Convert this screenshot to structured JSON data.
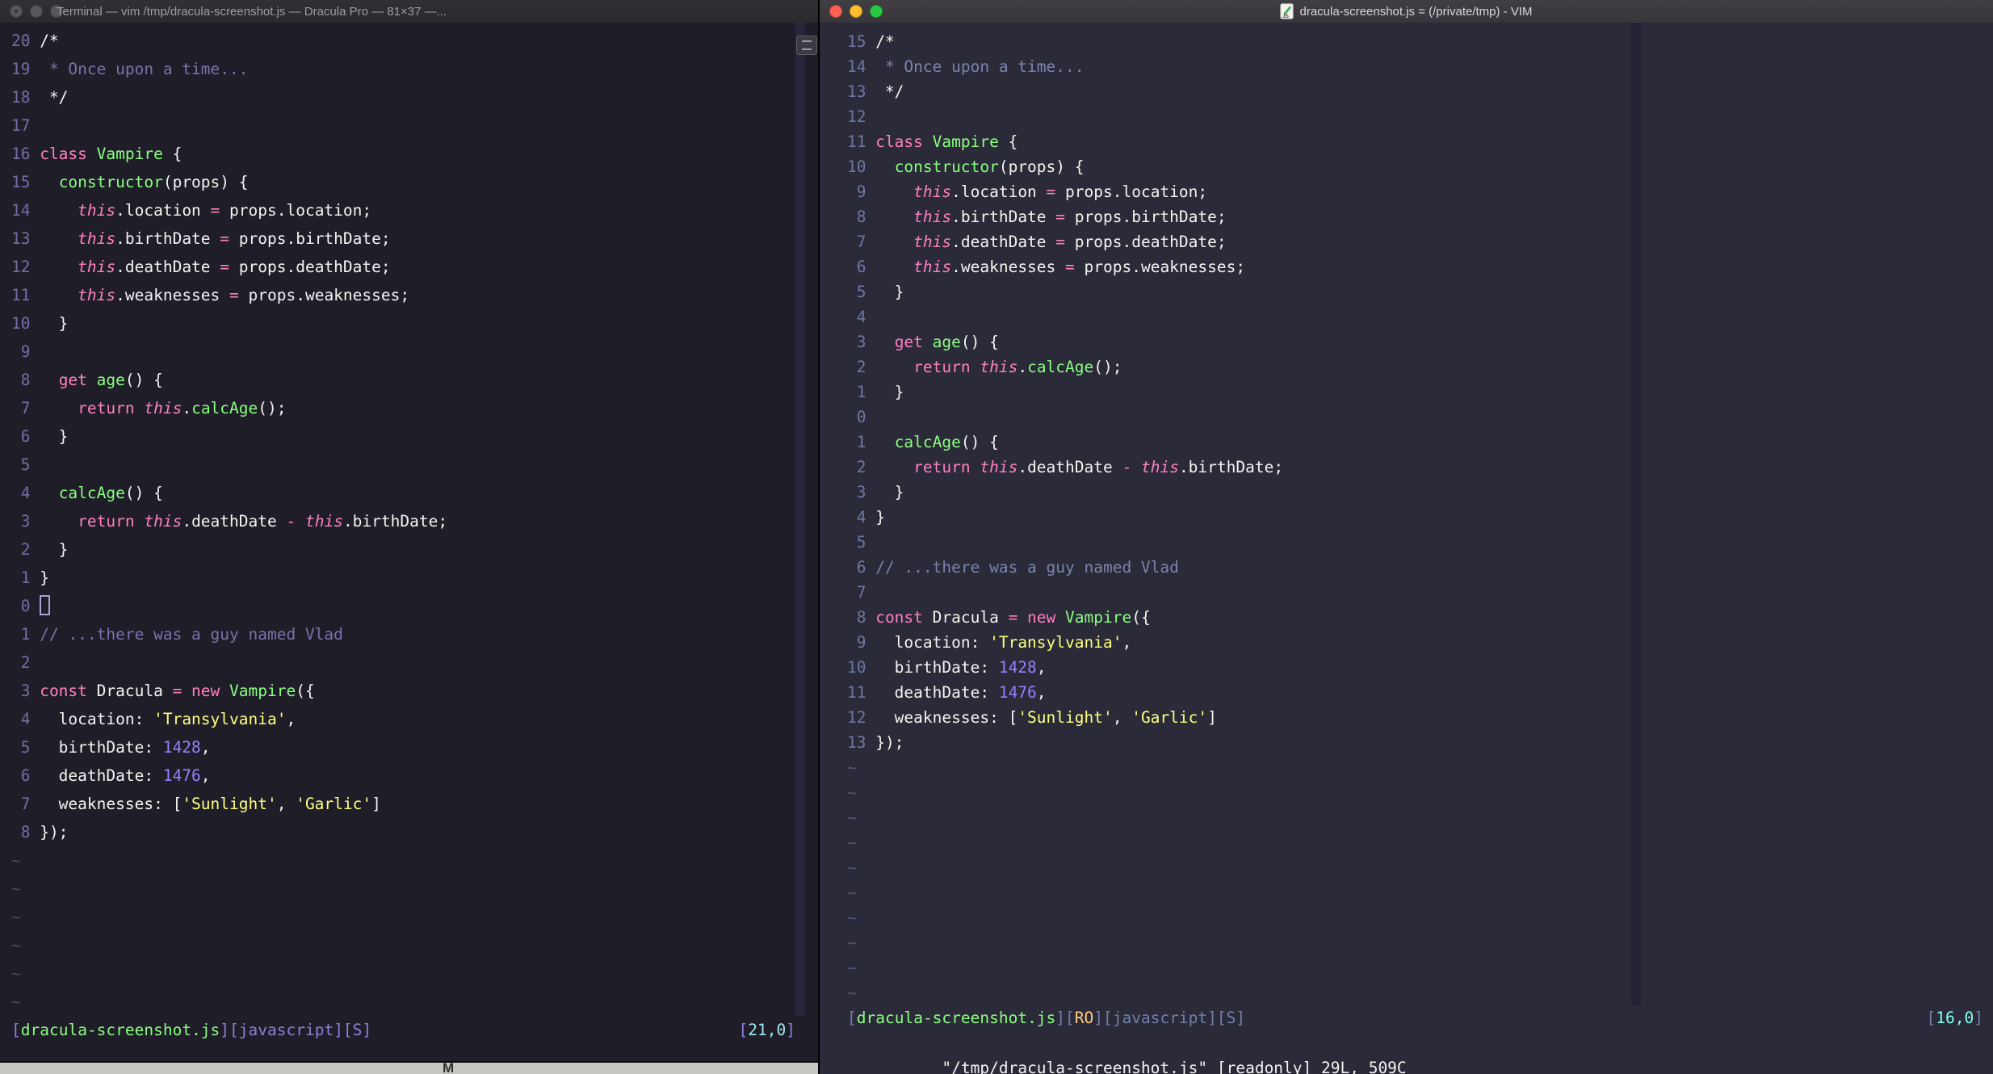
{
  "palette": {
    "terminal_bg": "#1f1e28",
    "gui_bg": "#2a2a38",
    "foreground": "#f4f4ef",
    "pink": "#ff80bf",
    "green": "#8aff80",
    "yellow": "#ffff80",
    "purple": "#9580ff",
    "comment": "#7a72ab",
    "cyan": "#80ffea",
    "orange": "#ffca80",
    "traffic_red": "#ff5f57",
    "traffic_yellow": "#febc2e",
    "traffic_green": "#28c840"
  },
  "tilde_char": "~",
  "desktop": {
    "glyph": "M"
  },
  "left_window": {
    "title": "Terminal — vim /tmp/dracula-screenshot.js — Dracula Pro — 81×37 —...",
    "tildes": 6,
    "command_line": "",
    "status_tokens": [
      [
        "br",
        "["
      ],
      [
        "sg",
        "dracula-screenshot.js"
      ],
      [
        "br",
        "]["
      ],
      [
        "si",
        "javascript"
      ],
      [
        "br",
        "]["
      ],
      [
        "si",
        "S"
      ],
      [
        "br",
        "]"
      ]
    ],
    "ruler_tokens": [
      [
        "br",
        "["
      ],
      [
        "sc",
        "21,0"
      ],
      [
        "br",
        "]"
      ]
    ],
    "code_lines": [
      {
        "n": "20",
        "t": [
          [
            "fg",
            "/*"
          ]
        ]
      },
      {
        "n": "19",
        "t": [
          [
            "cm",
            " * Once upon a time..."
          ]
        ]
      },
      {
        "n": "18",
        "t": [
          [
            "fg",
            " */"
          ]
        ]
      },
      {
        "n": "17",
        "t": []
      },
      {
        "n": "16",
        "t": [
          [
            "pk",
            "class "
          ],
          [
            "gr",
            "Vampire"
          ],
          [
            "fg",
            " {"
          ]
        ]
      },
      {
        "n": "15",
        "t": [
          [
            "fg",
            "  "
          ],
          [
            "gr",
            "constructor"
          ],
          [
            "fg",
            "(props) {"
          ]
        ]
      },
      {
        "n": "14",
        "t": [
          [
            "fg",
            "    "
          ],
          [
            "pki",
            "this"
          ],
          [
            "fg",
            ".location "
          ],
          [
            "pk",
            "="
          ],
          [
            "fg",
            " props.location;"
          ]
        ]
      },
      {
        "n": "13",
        "t": [
          [
            "fg",
            "    "
          ],
          [
            "pki",
            "this"
          ],
          [
            "fg",
            ".birthDate "
          ],
          [
            "pk",
            "="
          ],
          [
            "fg",
            " props.birthDate;"
          ]
        ]
      },
      {
        "n": "12",
        "t": [
          [
            "fg",
            "    "
          ],
          [
            "pki",
            "this"
          ],
          [
            "fg",
            ".deathDate "
          ],
          [
            "pk",
            "="
          ],
          [
            "fg",
            " props.deathDate;"
          ]
        ]
      },
      {
        "n": "11",
        "t": [
          [
            "fg",
            "    "
          ],
          [
            "pki",
            "this"
          ],
          [
            "fg",
            ".weaknesses "
          ],
          [
            "pk",
            "="
          ],
          [
            "fg",
            " props.weaknesses;"
          ]
        ]
      },
      {
        "n": "10",
        "t": [
          [
            "fg",
            "  }"
          ]
        ]
      },
      {
        "n": "9",
        "t": []
      },
      {
        "n": "8",
        "t": [
          [
            "fg",
            "  "
          ],
          [
            "pk",
            "get "
          ],
          [
            "gr",
            "age"
          ],
          [
            "fg",
            "() {"
          ]
        ]
      },
      {
        "n": "7",
        "t": [
          [
            "fg",
            "    "
          ],
          [
            "pk",
            "return "
          ],
          [
            "pki",
            "this"
          ],
          [
            "fg",
            "."
          ],
          [
            "gr",
            "calcAge"
          ],
          [
            "fg",
            "();"
          ]
        ]
      },
      {
        "n": "6",
        "t": [
          [
            "fg",
            "  }"
          ]
        ]
      },
      {
        "n": "5",
        "t": []
      },
      {
        "n": "4",
        "t": [
          [
            "fg",
            "  "
          ],
          [
            "gr",
            "calcAge"
          ],
          [
            "fg",
            "() {"
          ]
        ]
      },
      {
        "n": "3",
        "t": [
          [
            "fg",
            "    "
          ],
          [
            "pk",
            "return "
          ],
          [
            "pki",
            "this"
          ],
          [
            "fg",
            ".deathDate "
          ],
          [
            "pk",
            "-"
          ],
          [
            "fg",
            " "
          ],
          [
            "pki",
            "this"
          ],
          [
            "fg",
            ".birthDate;"
          ]
        ]
      },
      {
        "n": "2",
        "t": [
          [
            "fg",
            "  }"
          ]
        ]
      },
      {
        "n": "1",
        "t": [
          [
            "fg",
            "}"
          ]
        ]
      },
      {
        "n": "0",
        "t": [
          [
            "cur",
            ""
          ]
        ]
      },
      {
        "n": "1",
        "t": [
          [
            "cm",
            "// ...there was a guy named Vlad"
          ]
        ]
      },
      {
        "n": "2",
        "t": []
      },
      {
        "n": "3",
        "t": [
          [
            "pk",
            "const "
          ],
          [
            "fg",
            "Dracula "
          ],
          [
            "pk",
            "= new "
          ],
          [
            "gr",
            "Vampire"
          ],
          [
            "fg",
            "({"
          ]
        ]
      },
      {
        "n": "4",
        "t": [
          [
            "fg",
            "  location: "
          ],
          [
            "yl",
            "'Transylvania'"
          ],
          [
            "fg",
            ","
          ]
        ]
      },
      {
        "n": "5",
        "t": [
          [
            "fg",
            "  birthDate: "
          ],
          [
            "pu",
            "1428"
          ],
          [
            "fg",
            ","
          ]
        ]
      },
      {
        "n": "6",
        "t": [
          [
            "fg",
            "  deathDate: "
          ],
          [
            "pu",
            "1476"
          ],
          [
            "fg",
            ","
          ]
        ]
      },
      {
        "n": "7",
        "t": [
          [
            "fg",
            "  weaknesses: ["
          ],
          [
            "yl",
            "'Sunlight'"
          ],
          [
            "fg",
            ", "
          ],
          [
            "yl",
            "'Garlic'"
          ],
          [
            "fg",
            "]"
          ]
        ]
      },
      {
        "n": "8",
        "t": [
          [
            "fg",
            "});"
          ]
        ]
      }
    ]
  },
  "right_window": {
    "title": "dracula-screenshot.js = (/private/tmp) - VIM",
    "tildes": 10,
    "command_line": "\"/tmp/dracula-screenshot.js\" [readonly] 29L, 509C",
    "status_tokens": [
      [
        "br",
        "["
      ],
      [
        "sg",
        "dracula-screenshot.js"
      ],
      [
        "br",
        "]["
      ],
      [
        "so",
        "RO"
      ],
      [
        "br",
        "]["
      ],
      [
        "si",
        "javascript"
      ],
      [
        "br",
        "]["
      ],
      [
        "si",
        "S"
      ],
      [
        "br",
        "]"
      ]
    ],
    "ruler_tokens": [
      [
        "br",
        "["
      ],
      [
        "sc",
        "16,0"
      ],
      [
        "br",
        "]"
      ]
    ],
    "code_lines": [
      {
        "n": "15",
        "t": [
          [
            "fg",
            "/*"
          ]
        ]
      },
      {
        "n": "14",
        "t": [
          [
            "cm",
            " * Once upon a time..."
          ]
        ]
      },
      {
        "n": "13",
        "t": [
          [
            "fg",
            " */"
          ]
        ]
      },
      {
        "n": "12",
        "t": []
      },
      {
        "n": "11",
        "t": [
          [
            "pk",
            "class "
          ],
          [
            "gr",
            "Vampire"
          ],
          [
            "fg",
            " {"
          ]
        ]
      },
      {
        "n": "10",
        "t": [
          [
            "fg",
            "  "
          ],
          [
            "gr",
            "constructor"
          ],
          [
            "fg",
            "(props) {"
          ]
        ]
      },
      {
        "n": "9",
        "t": [
          [
            "fg",
            "    "
          ],
          [
            "pki",
            "this"
          ],
          [
            "fg",
            ".location "
          ],
          [
            "pk",
            "="
          ],
          [
            "fg",
            " props.location;"
          ]
        ]
      },
      {
        "n": "8",
        "t": [
          [
            "fg",
            "    "
          ],
          [
            "pki",
            "this"
          ],
          [
            "fg",
            ".birthDate "
          ],
          [
            "pk",
            "="
          ],
          [
            "fg",
            " props.birthDate;"
          ]
        ]
      },
      {
        "n": "7",
        "t": [
          [
            "fg",
            "    "
          ],
          [
            "pki",
            "this"
          ],
          [
            "fg",
            ".deathDate "
          ],
          [
            "pk",
            "="
          ],
          [
            "fg",
            " props.deathDate;"
          ]
        ]
      },
      {
        "n": "6",
        "t": [
          [
            "fg",
            "    "
          ],
          [
            "pki",
            "this"
          ],
          [
            "fg",
            ".weaknesses "
          ],
          [
            "pk",
            "="
          ],
          [
            "fg",
            " props.weaknesses;"
          ]
        ]
      },
      {
        "n": "5",
        "t": [
          [
            "fg",
            "  }"
          ]
        ]
      },
      {
        "n": "4",
        "t": []
      },
      {
        "n": "3",
        "t": [
          [
            "fg",
            "  "
          ],
          [
            "pk",
            "get "
          ],
          [
            "gr",
            "age"
          ],
          [
            "fg",
            "() {"
          ]
        ]
      },
      {
        "n": "2",
        "t": [
          [
            "fg",
            "    "
          ],
          [
            "pk",
            "return "
          ],
          [
            "pki",
            "this"
          ],
          [
            "fg",
            "."
          ],
          [
            "gr",
            "calcAge"
          ],
          [
            "fg",
            "();"
          ]
        ]
      },
      {
        "n": "1",
        "t": [
          [
            "fg",
            "  }"
          ]
        ]
      },
      {
        "n": "0",
        "t": []
      },
      {
        "n": "1",
        "t": [
          [
            "fg",
            "  "
          ],
          [
            "gr",
            "calcAge"
          ],
          [
            "fg",
            "() {"
          ]
        ]
      },
      {
        "n": "2",
        "t": [
          [
            "fg",
            "    "
          ],
          [
            "pk",
            "return "
          ],
          [
            "pki",
            "this"
          ],
          [
            "fg",
            ".deathDate "
          ],
          [
            "pk",
            "-"
          ],
          [
            "fg",
            " "
          ],
          [
            "pki",
            "this"
          ],
          [
            "fg",
            ".birthDate;"
          ]
        ]
      },
      {
        "n": "3",
        "t": [
          [
            "fg",
            "  }"
          ]
        ]
      },
      {
        "n": "4",
        "t": [
          [
            "fg",
            "}"
          ]
        ]
      },
      {
        "n": "5",
        "t": []
      },
      {
        "n": "6",
        "t": [
          [
            "cm",
            "// ...there was a guy named Vlad"
          ]
        ]
      },
      {
        "n": "7",
        "t": []
      },
      {
        "n": "8",
        "t": [
          [
            "pk",
            "const "
          ],
          [
            "fg",
            "Dracula "
          ],
          [
            "pk",
            "= new "
          ],
          [
            "gr",
            "Vampire"
          ],
          [
            "fg",
            "({"
          ]
        ]
      },
      {
        "n": "9",
        "t": [
          [
            "fg",
            "  location: "
          ],
          [
            "yl",
            "'Transylvania'"
          ],
          [
            "fg",
            ","
          ]
        ]
      },
      {
        "n": "10",
        "t": [
          [
            "fg",
            "  birthDate: "
          ],
          [
            "pu",
            "1428"
          ],
          [
            "fg",
            ","
          ]
        ]
      },
      {
        "n": "11",
        "t": [
          [
            "fg",
            "  deathDate: "
          ],
          [
            "pu",
            "1476"
          ],
          [
            "fg",
            ","
          ]
        ]
      },
      {
        "n": "12",
        "t": [
          [
            "fg",
            "  weaknesses: ["
          ],
          [
            "yl",
            "'Sunlight'"
          ],
          [
            "fg",
            ", "
          ],
          [
            "yl",
            "'Garlic'"
          ],
          [
            "fg",
            "]"
          ]
        ]
      },
      {
        "n": "13",
        "t": [
          [
            "fg",
            "});"
          ]
        ]
      }
    ]
  }
}
